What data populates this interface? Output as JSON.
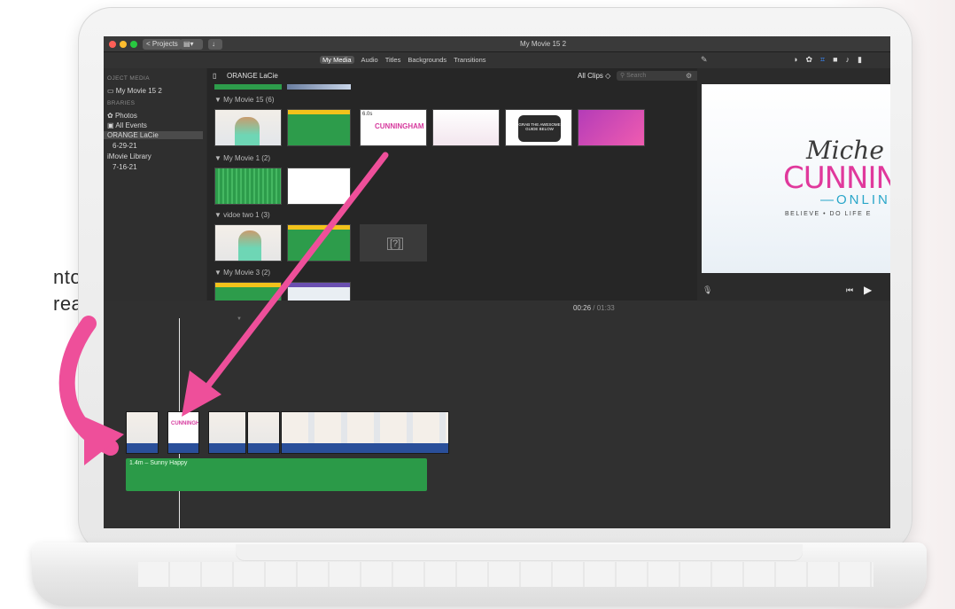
{
  "side_text": {
    "line1": "nto",
    "line2": "rea."
  },
  "window": {
    "title": "My Movie 15 2",
    "projects_button": "< Projects"
  },
  "toolbar": {
    "tabs": [
      "My Media",
      "Audio",
      "Titles",
      "Backgrounds",
      "Transitions"
    ],
    "active_tab": "My Media"
  },
  "sidebar": {
    "project_media_header": "OJECT MEDIA",
    "project_item": "My Movie 15 2",
    "libraries_header": "BRARIES",
    "items": [
      "Photos",
      "All Events",
      "ORANGE LaCie",
      "6-29-21",
      "iMovie Library",
      "7-16-21"
    ],
    "selected": "ORANGE LaCie"
  },
  "browser": {
    "library_title": "ORANGE LaCie",
    "filter": "All Clips",
    "search_placeholder": "Search",
    "events": [
      {
        "label": "▼ My Movie 15  (6)"
      },
      {
        "label": "▼ My Movie 1  (2)"
      },
      {
        "label": "▼ vidoe two 1  (3)"
      },
      {
        "label": "▼ My Movie 3  (2)"
      }
    ],
    "thumb_label": "6.0s",
    "thumb_text": "GRAB THE AWESOME GUIDE BELOW",
    "missing": "[?]"
  },
  "viewer": {
    "brand_top": "Miche",
    "brand_mid": "CUNNING",
    "brand_sub": "—ONLIN",
    "brand_tag": "BELIEVE • DO LIFE E"
  },
  "timeline": {
    "timecode": "00:26",
    "duration": "01:33",
    "music_label": "1.4m – Sunny Happy"
  },
  "colors": {
    "arrow": "#ee4f9a",
    "music": "#2b9a48",
    "strip": "#2a4f9a"
  }
}
